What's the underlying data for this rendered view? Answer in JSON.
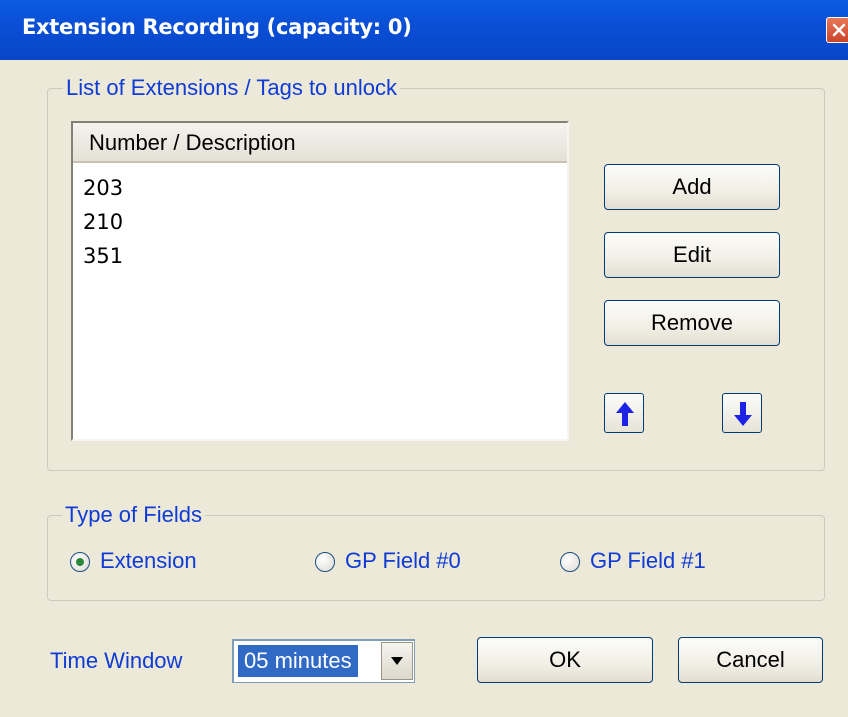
{
  "window": {
    "title": "Extension Recording (capacity: 0)"
  },
  "extensions_group": {
    "title": "List of Extensions / Tags to unlock",
    "list": {
      "column_header": "Number / Description",
      "items": [
        "203",
        "210",
        "351"
      ]
    },
    "buttons": {
      "add": "Add",
      "edit": "Edit",
      "remove": "Remove"
    },
    "icons": {
      "move_up": "arrow-up-icon",
      "move_down": "arrow-down-icon"
    }
  },
  "fields_group": {
    "title": "Type of Fields",
    "options": [
      {
        "label": "Extension",
        "selected": true
      },
      {
        "label": "GP Field #0",
        "selected": false
      },
      {
        "label": "GP Field #1",
        "selected": false
      }
    ]
  },
  "time_window": {
    "label": "Time Window",
    "selected_value": "05 minutes"
  },
  "actions": {
    "ok": "OK",
    "cancel": "Cancel"
  },
  "colors": {
    "titlebar": "#0a4fd6",
    "label_blue": "#0f3bd6",
    "arrow_blue": "#1e22e6",
    "dialog_bg": "#ece9d8",
    "selection": "#316ac5"
  }
}
